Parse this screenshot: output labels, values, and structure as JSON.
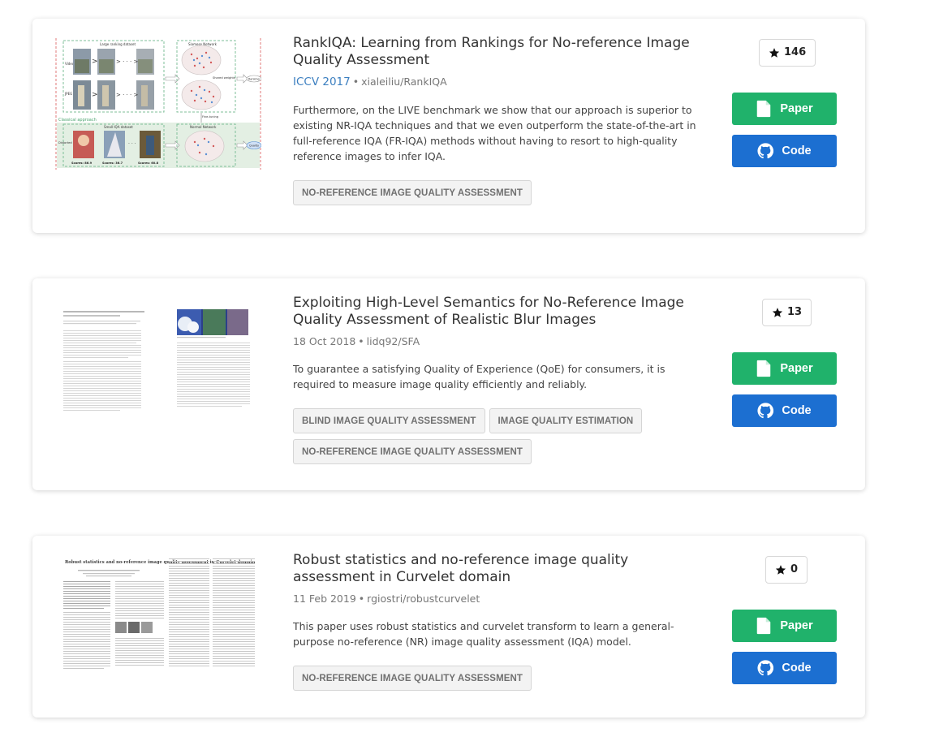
{
  "papers": [
    {
      "title": "RankIQA: Learning from Rankings for No-reference Image Quality Assessment",
      "venue": "ICCV 2017",
      "repo": "xialeiliu/RankIQA",
      "abstract": "Furthermore, on the LIVE benchmark we show that our approach is superior to existing NR-IQA techniques and that we even outperform the state-of-the-art in full-reference IQA (FR-IQA) methods without having to resort to high-quality reference images to infer IQA.",
      "tags": [
        "NO-REFERENCE IMAGE QUALITY ASSESSMENT"
      ],
      "stars": "146",
      "paper_label": "Paper",
      "code_label": "Code",
      "thumb_texts": {
        "ranking_dataset": "Large ranking dataset",
        "siamese": "Siamese Network",
        "shared_weights": "Shared weights",
        "ranking": "Ranking",
        "fine_tuning": "Fine-tuning",
        "classical": "Classical approach",
        "small_iqa": "Small IQA dataset",
        "normal_net": "Normal Network",
        "quality": "Quality",
        "distorted": "Distorted images",
        "video": "Video",
        "jpeg": "JPEG",
        "score1": "Scores: 86.9",
        "score2": "Scores: 36.7",
        "score3": "Scores: 60.8"
      }
    },
    {
      "title": "Exploiting High-Level Semantics for No-Reference Image Quality Assessment of Realistic Blur Images",
      "date": "18 Oct 2018",
      "repo": "lidq92/SFA",
      "abstract": "To guarantee a satisfying Quality of Experience (QoE) for consumers, it is required to measure image quality efficiently and reliably.",
      "tags": [
        "BLIND IMAGE QUALITY ASSESSMENT",
        "IMAGE QUALITY ESTIMATION",
        "NO-REFERENCE IMAGE QUALITY ASSESSMENT"
      ],
      "stars": "13",
      "paper_label": "Paper",
      "code_label": "Code"
    },
    {
      "title": "Robust statistics and no-reference image quality assessment in Curvelet domain",
      "date": "11 Feb 2019",
      "repo": "rgiostri/robustcurvelet",
      "abstract": "This paper uses robust statistics and curvelet transform to learn a general-purpose no-reference (NR) image quality assessment (IQA) model.",
      "tags": [
        "NO-REFERENCE IMAGE QUALITY ASSESSMENT"
      ],
      "stars": "0",
      "paper_label": "Paper",
      "code_label": "Code",
      "thumb_title": "Robust statistics and no-reference image quality assessment in Curvelet domain"
    }
  ],
  "colors": {
    "paper_button": "#20b26b",
    "code_button": "#1c6fd1",
    "venue_link": "#3c7fc0",
    "tag_bg": "#f3f3f3"
  },
  "icons": [
    "star-icon",
    "document-icon",
    "github-icon"
  ]
}
